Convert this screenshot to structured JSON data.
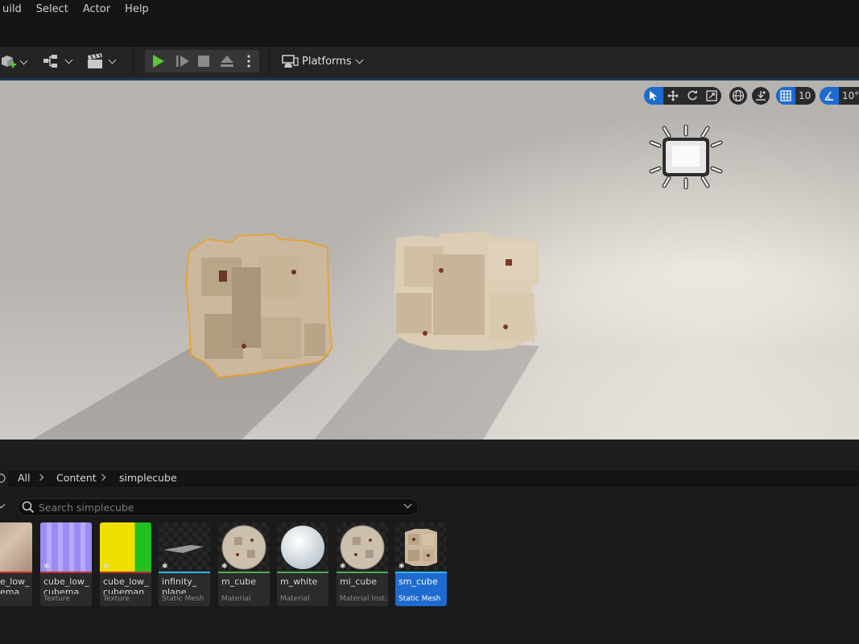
{
  "menu": {
    "items": [
      "uild",
      "Select",
      "Actor",
      "Help"
    ]
  },
  "toolbar": {
    "platforms_label": "Platforms",
    "icons": [
      "add-actor-icon",
      "blueprint-icon",
      "cinematics-icon",
      "play-icon",
      "advance-frame-icon",
      "stop-icon",
      "eject-icon",
      "more-options-icon",
      "platforms-icon"
    ]
  },
  "viewport": {
    "grid_snap_value": "10",
    "rotation_snap_value": "10°",
    "scene": {
      "light_icon": "directional-light-icon",
      "cube_left_selected": true,
      "selection_color": "#f0a018"
    }
  },
  "content_browser": {
    "breadcrumb": [
      "All",
      "Content",
      "simplecube"
    ],
    "search": {
      "placeholder": "Search simplecube",
      "value": ""
    },
    "assets": [
      {
        "name": "cube_low_",
        "name2": "cubema",
        "type": "ture",
        "bar_color": "#c03030",
        "kind": "basecolor"
      },
      {
        "name": "cube_low_",
        "name2": "cubema",
        "type": "Texture",
        "bar_color": "#c03030",
        "kind": "normal"
      },
      {
        "name": "cube_low_",
        "name2": "cubeman",
        "type": "Texture",
        "bar_color": "#c03030",
        "kind": "orm"
      },
      {
        "name": "infinity_",
        "name2": "plane",
        "type": "Static Mesh",
        "bar_color": "#33b5e5",
        "kind": "plane"
      },
      {
        "name": "m_cube",
        "name2": "",
        "type": "Material",
        "bar_color": "#4caf50",
        "kind": "sphere-tex"
      },
      {
        "name": "m_white",
        "name2": "",
        "type": "Material",
        "bar_color": "#4caf50",
        "kind": "sphere-white"
      },
      {
        "name": "mi_cube",
        "name2": "",
        "type": "Material Inst...",
        "bar_color": "#4caf50",
        "kind": "sphere-tex"
      },
      {
        "name": "sm_cube",
        "name2": "",
        "type": "Static Mesh",
        "bar_color": "#33b5e5",
        "kind": "mesh",
        "selected": true
      }
    ]
  },
  "colors": {
    "accent": "#1e6bd0",
    "play_green": "#5dc33a",
    "panel": "#242424"
  }
}
